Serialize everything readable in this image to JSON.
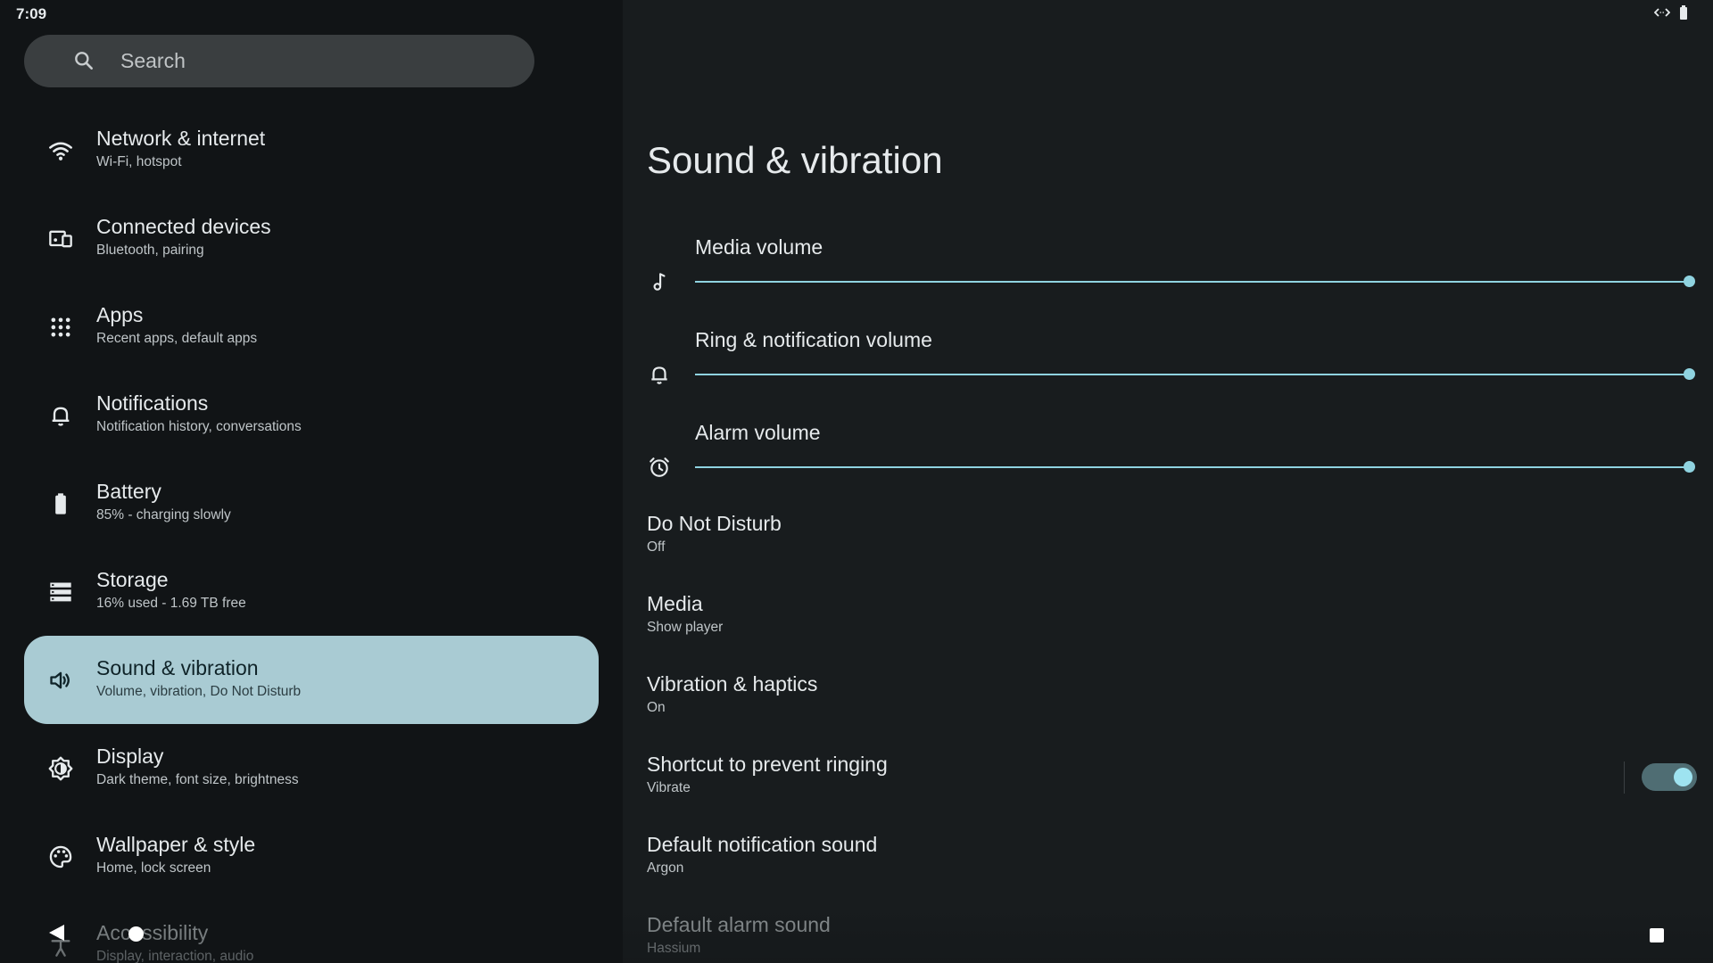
{
  "status_bar": {
    "time": "7:09"
  },
  "search": {
    "placeholder": "Search"
  },
  "nav": {
    "items": [
      {
        "title": "Network & internet",
        "subtitle": "Wi‑Fi, hotspot",
        "icon": "wifi-icon"
      },
      {
        "title": "Connected devices",
        "subtitle": "Bluetooth, pairing",
        "icon": "devices-icon"
      },
      {
        "title": "Apps",
        "subtitle": "Recent apps, default apps",
        "icon": "apps-grid-icon"
      },
      {
        "title": "Notifications",
        "subtitle": "Notification history, conversations",
        "icon": "bell-icon"
      },
      {
        "title": "Battery",
        "subtitle": "85% - charging slowly",
        "icon": "battery-icon"
      },
      {
        "title": "Storage",
        "subtitle": "16% used - 1.69 TB free",
        "icon": "storage-icon"
      },
      {
        "title": "Sound & vibration",
        "subtitle": "Volume, vibration, Do Not Disturb",
        "icon": "speaker-icon",
        "selected": true
      },
      {
        "title": "Display",
        "subtitle": "Dark theme, font size, brightness",
        "icon": "brightness-icon"
      },
      {
        "title": "Wallpaper & style",
        "subtitle": "Home, lock screen",
        "icon": "palette-icon"
      },
      {
        "title": "Accessibility",
        "subtitle": "Display, interaction, audio",
        "icon": "accessibility-icon"
      }
    ]
  },
  "detail": {
    "title": "Sound & vibration",
    "volumes": [
      {
        "label": "Media volume",
        "icon": "music-note-icon",
        "level": 1.0
      },
      {
        "label": "Ring & notification volume",
        "icon": "bell-icon",
        "level": 1.0
      },
      {
        "label": "Alarm volume",
        "icon": "alarm-icon",
        "level": 1.0
      }
    ],
    "prefs": [
      {
        "title": "Do Not Disturb",
        "subtitle": "Off"
      },
      {
        "title": "Media",
        "subtitle": "Show player"
      },
      {
        "title": "Vibration & haptics",
        "subtitle": "On"
      },
      {
        "title": "Shortcut to prevent ringing",
        "subtitle": "Vibrate",
        "toggle": true
      },
      {
        "title": "Default notification sound",
        "subtitle": "Argon"
      },
      {
        "title": "Default alarm sound",
        "subtitle": "Hassium"
      }
    ]
  },
  "colors": {
    "accent": "#8fd3e0",
    "selected_bg": "#a9cbd3",
    "left_bg": "#111416",
    "right_bg": "#181c1e"
  }
}
